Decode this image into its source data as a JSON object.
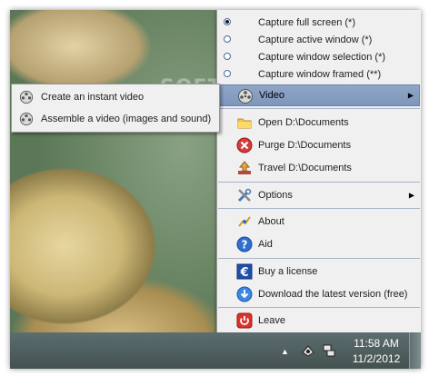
{
  "watermark": "SOFTPEDIA",
  "menu": {
    "capture_items": [
      {
        "label": "Capture full screen (*)",
        "selected": true
      },
      {
        "label": "Capture active window (*)",
        "selected": false
      },
      {
        "label": "Capture window selection (*)",
        "selected": false
      },
      {
        "label": "Capture window framed (**)",
        "selected": false
      }
    ],
    "video_label": "Video",
    "folder_items": [
      {
        "label": "Open D:\\Documents",
        "icon": "folder-icon"
      },
      {
        "label": "Purge D:\\Documents",
        "icon": "purge-icon"
      },
      {
        "label": "Travel D:\\Documents",
        "icon": "travel-icon"
      }
    ],
    "options_label": "Options",
    "help_items": [
      {
        "label": "About",
        "icon": "about-icon"
      },
      {
        "label": "Aid",
        "icon": "help-icon"
      }
    ],
    "license_items": [
      {
        "label": "Buy a license",
        "icon": "euro-icon"
      },
      {
        "label": "Download the latest version (free)",
        "icon": "download-icon"
      }
    ],
    "leave_label": "Leave"
  },
  "submenu": {
    "items": [
      {
        "label": "Create an instant video",
        "icon": "film-reel-icon"
      },
      {
        "label": "Assemble a video (images and sound)",
        "icon": "film-reel-icon"
      }
    ]
  },
  "taskbar": {
    "time": "11:58 AM",
    "date": "11/2/2012"
  },
  "colors": {
    "menu_bg": "#f0f0f0",
    "highlight": "#8fa6c7",
    "taskbar": "#4f5e5f"
  }
}
